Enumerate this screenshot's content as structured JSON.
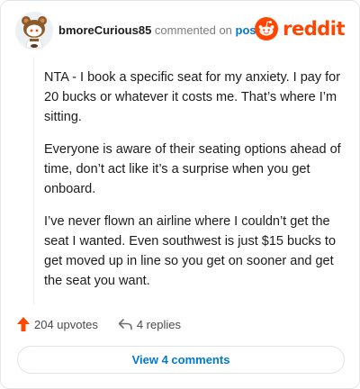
{
  "header": {
    "username": "bmoreCurious85",
    "action_text": " commented on ",
    "post_link": "post",
    "brand_name": "reddit",
    "brand_color": "#ff4500"
  },
  "comment": {
    "paragraphs": [
      "NTA - I book a specific seat for my anxiety. I pay for 20 bucks or whatever it costs me. That’s where I’m sitting.",
      "Everyone is aware of their seating options ahead of time, don’t act like it’s a surprise when you get onboard.",
      "I’ve never flown an airline where I couldn’t get the seat I wanted. Even southwest is just $15 bucks to get moved up in line so you get on sooner and get the seat you want."
    ]
  },
  "footer": {
    "upvotes_label": "204 upvotes",
    "replies_label": "4 replies",
    "view_comments_label": "View 4 comments",
    "upvote_icon": "upvote-arrow-icon",
    "reply_icon": "reply-arrow-icon"
  }
}
